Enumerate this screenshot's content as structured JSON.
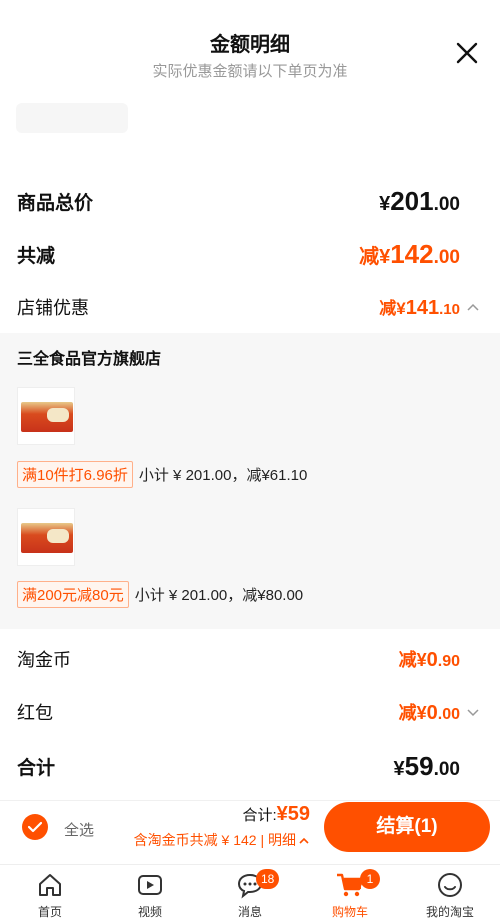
{
  "header": {
    "title": "金额明细",
    "subtitle": "实际优惠金额请以下单页为准"
  },
  "summary": {
    "goods_total_label": "商品总价",
    "goods_total": {
      "symbol": "¥",
      "int": "201",
      "dec": ".00"
    },
    "total_discount_label": "共减",
    "total_discount": {
      "prefix": "减",
      "symbol": "¥",
      "int": "142",
      "dec": ".00"
    },
    "shop_discount_label": "店铺优惠",
    "shop_discount": {
      "prefix": "减",
      "symbol": "¥",
      "int": "141",
      "dec": ".10"
    }
  },
  "shop": {
    "name": "三全食品官方旗舰店",
    "items": [
      {
        "promo_tag": "满10件打6.96折",
        "subtotal": "小计 ¥ 201.00，减¥61.10"
      },
      {
        "promo_tag": "满200元减80元",
        "subtotal": "小计 ¥ 201.00，减¥80.00"
      }
    ]
  },
  "extras": {
    "coin_label": "淘金币",
    "coin_value": {
      "prefix": "减",
      "symbol": "¥",
      "int": "0",
      "dec": ".90"
    },
    "redpacket_label": "红包",
    "redpacket_value": {
      "prefix": "减",
      "symbol": "¥",
      "int": "0",
      "dec": ".00"
    },
    "sum_label": "合计",
    "sum_value": {
      "symbol": "¥",
      "int": "59",
      "dec": ".00"
    }
  },
  "bottom": {
    "select_all": "全选",
    "total_label": "合计:",
    "total_value": "¥59",
    "detail_line": "含淘金币共减 ¥ 142 | 明细",
    "checkout": "结算(1)"
  },
  "tabs": [
    {
      "label": "首页",
      "icon": "home-icon"
    },
    {
      "label": "视频",
      "icon": "video-icon"
    },
    {
      "label": "消息",
      "icon": "message-icon",
      "badge": "18"
    },
    {
      "label": "购物车",
      "icon": "cart-icon",
      "badge": "1",
      "active": true
    },
    {
      "label": "我的淘宝",
      "icon": "profile-icon"
    }
  ],
  "colors": {
    "accent": "#ff5000"
  }
}
